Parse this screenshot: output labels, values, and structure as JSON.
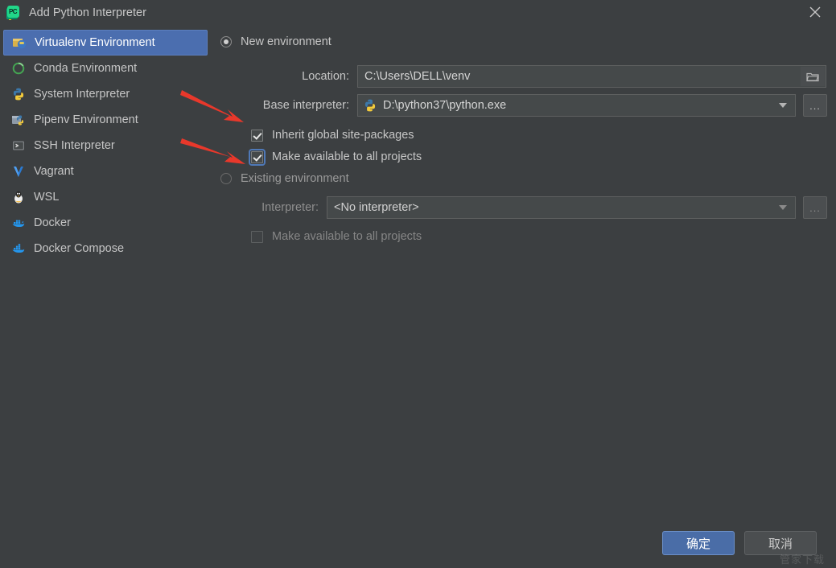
{
  "window": {
    "title": "Add Python Interpreter",
    "app_icon": "pycharm-icon",
    "close_icon": "close-icon"
  },
  "sidebar": {
    "items": [
      {
        "label": "Virtualenv Environment",
        "icon": "virtualenv-icon",
        "selected": true
      },
      {
        "label": "Conda Environment",
        "icon": "conda-icon",
        "selected": false
      },
      {
        "label": "System Interpreter",
        "icon": "python-icon",
        "selected": false
      },
      {
        "label": "Pipenv Environment",
        "icon": "pipenv-icon",
        "selected": false
      },
      {
        "label": "SSH Interpreter",
        "icon": "ssh-icon",
        "selected": false
      },
      {
        "label": "Vagrant",
        "icon": "vagrant-icon",
        "selected": false
      },
      {
        "label": "WSL",
        "icon": "wsl-icon",
        "selected": false
      },
      {
        "label": "Docker",
        "icon": "docker-icon",
        "selected": false
      },
      {
        "label": "Docker Compose",
        "icon": "docker-compose-icon",
        "selected": false
      }
    ]
  },
  "main": {
    "new_environment": {
      "radio_label": "New environment",
      "selected": true,
      "location": {
        "label": "Location:",
        "value": "C:\\Users\\DELL\\venv",
        "browse_icon": "folder-icon"
      },
      "base_interpreter": {
        "label": "Base interpreter:",
        "value": "D:\\python37\\python.exe",
        "icon": "python-icon",
        "dropdown_icon": "chevron-down-icon",
        "browse_label": "..."
      },
      "inherit_global_site_packages": {
        "label": "Inherit global site-packages",
        "checked": true
      },
      "make_available_to_all_projects": {
        "label": "Make available to all projects",
        "checked": true
      }
    },
    "existing_environment": {
      "radio_label": "Existing environment",
      "selected": false,
      "interpreter": {
        "label": "Interpreter:",
        "value": "<No interpreter>",
        "dropdown_icon": "chevron-down-icon",
        "browse_label": "..."
      },
      "make_available_to_all_projects": {
        "label": "Make available to all projects",
        "checked": false
      }
    }
  },
  "footer": {
    "ok_label": "确定",
    "cancel_label": "取消"
  },
  "watermark": {
    "text": "管家下载"
  },
  "annotations": {
    "arrow_1": "red-arrow-inherit-global-site-packages",
    "arrow_2": "red-arrow-make-available-to-all-projects",
    "color": "#e8382b"
  }
}
